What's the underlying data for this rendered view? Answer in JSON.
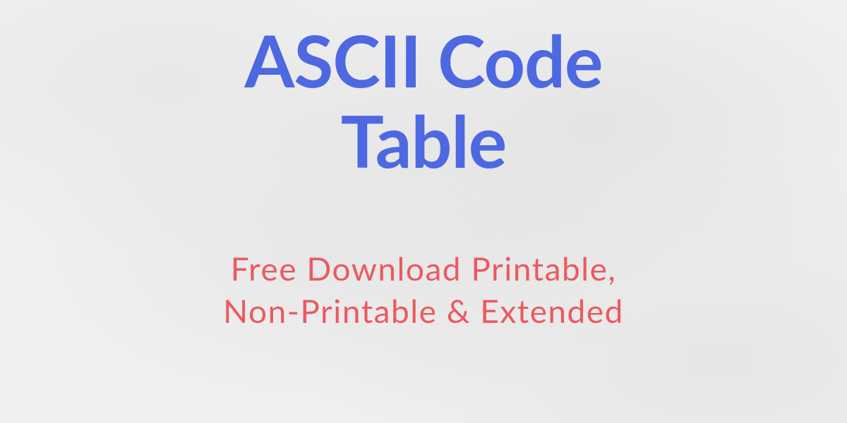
{
  "heading": {
    "title_line1": "ASCII Code",
    "title_line2": "Table",
    "subtitle_line1": "Free Download Printable,",
    "subtitle_line2": "Non-Printable & Extended"
  }
}
